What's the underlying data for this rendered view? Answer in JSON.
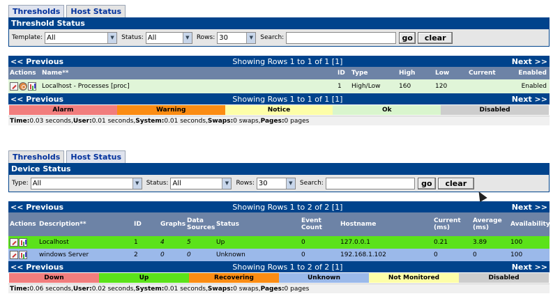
{
  "top": {
    "tabs": [
      "Thresholds",
      "Host Status"
    ],
    "panel_title": "Threshold Status",
    "filters": {
      "template_label": "Template:",
      "template_value": "All",
      "status_label": "Status:",
      "status_value": "All",
      "rows_label": "Rows:",
      "rows_value": "30",
      "search_label": "Search:",
      "search_value": "",
      "go": "go",
      "clear": "clear"
    },
    "nav": {
      "prev": "<< Previous",
      "showing": "Showing Rows 1 to 1 of 1 [1]",
      "next": "Next >>"
    },
    "columns": [
      "Actions",
      "Name**",
      "ID",
      "Type",
      "High",
      "Low",
      "Current",
      "Enabled"
    ],
    "rows": [
      {
        "name": "Localhost - Processes [proc]",
        "id": "1",
        "type": "High/Low",
        "high": "160",
        "low": "120",
        "current": "",
        "enabled": "Enabled"
      }
    ],
    "legend": [
      "Alarm",
      "Warning",
      "Notice",
      "Ok",
      "Disabled"
    ],
    "stats": {
      "time_label": "Time:",
      "time": " 0.03 seconds, ",
      "user_label": "User:",
      "user": " 0.01 seconds, ",
      "system_label": "System:",
      "system": " 0.01 seconds, ",
      "swaps_label": "Swaps:",
      "swaps": " 0 swaps,",
      "pages_label": "Pages:",
      "pages": " 0 pages"
    }
  },
  "bottom": {
    "tabs": [
      "Thresholds",
      "Host Status"
    ],
    "panel_title": "Device Status",
    "filters": {
      "type_label": "Type:",
      "type_value": "All",
      "status_label": "Status:",
      "status_value": "All",
      "rows_label": "Rows:",
      "rows_value": "30",
      "search_label": "Search:",
      "search_value": "",
      "go": "go",
      "clear": "clear"
    },
    "nav": {
      "prev": "<< Previous",
      "showing": "Showing Rows 1 to 2 of 2 [1]",
      "next": "Next >>"
    },
    "columns": [
      "Actions",
      "Description**",
      "ID",
      "Graphs",
      "Data Sources",
      "Status",
      "Event Count",
      "Hostname",
      "Current (ms)",
      "Average (ms)",
      "Availability"
    ],
    "rows": [
      {
        "desc": "Localhost",
        "id": "1",
        "graphs": "4",
        "ds": "5",
        "status": "Up",
        "events": "0",
        "host": "127.0.0.1",
        "cur": "0.21",
        "avg": "3.89",
        "avail": "100"
      },
      {
        "desc": "windows Server",
        "id": "2",
        "graphs": "0",
        "ds": "0",
        "status": "Unknown",
        "events": "0",
        "host": "192.168.1.102",
        "cur": "0",
        "avg": "0",
        "avail": "100"
      }
    ],
    "legend": [
      "Down",
      "Up",
      "Recovering",
      "Unknown",
      "Not Monitored",
      "Disabled"
    ],
    "stats": {
      "time_label": "Time:",
      "time": " 0.06 seconds, ",
      "user_label": "User:",
      "user": " 0.02 seconds, ",
      "system_label": "System:",
      "system": " 0.01 seconds, ",
      "swaps_label": "Swaps:",
      "swaps": " 0 swaps,",
      "pages_label": "Pages:",
      "pages": " 0 pages"
    }
  },
  "colors": {
    "header": "#00438c",
    "colhdr": "#6d83a6",
    "ok_row": "#e0f5d8",
    "up_row": "#5be21a",
    "unknown_row": "#9bb9ea"
  }
}
